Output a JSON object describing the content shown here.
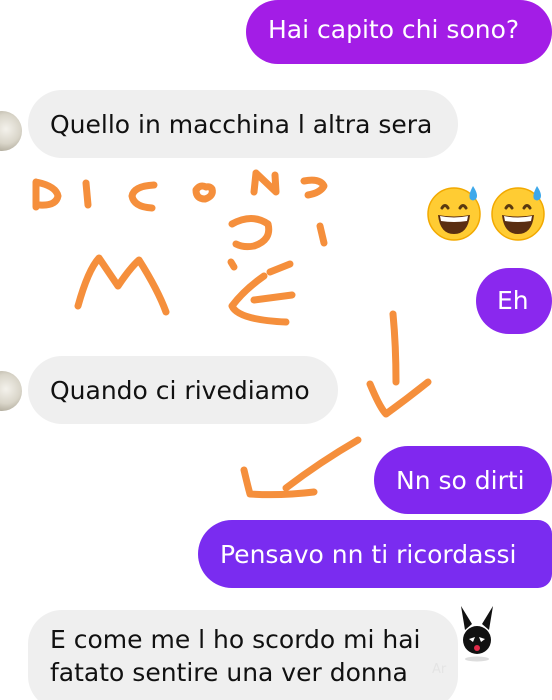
{
  "messages": {
    "m1": "Hai capito chi sono?",
    "m2": "Quello in macchina l altra sera",
    "m3": "Eh",
    "m4": "Quando ci rivediamo",
    "m5": "Nn so dirti",
    "m6": "Pensavo nn ti ricordassi",
    "m7_line1": "E come me l ho scordo mi hai",
    "m7_line2": "fatato sentire una ver donna"
  },
  "reactions": {
    "emoji_name": "grinning-face-with-sweat-emoji",
    "count": 2
  },
  "colors": {
    "outgoing_start": "#a21ee6",
    "outgoing_end": "#7a2cf0",
    "incoming_bg": "#efefef",
    "scribble": "#f58f3c"
  },
  "icons": {
    "avatar": "contact-avatar",
    "sticker": "bunny-sticker-icon"
  },
  "watermark": "Ar"
}
